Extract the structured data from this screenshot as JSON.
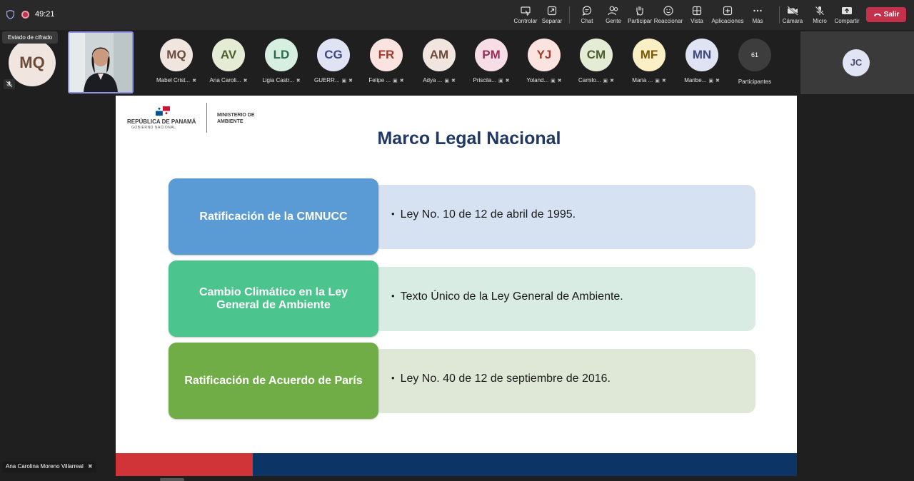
{
  "meeting": {
    "timer": "49:21",
    "tooltip": "Estado de cifrado",
    "self_initials": "MQ",
    "speaker_name": "Ana Carolina Moreno Villarreal"
  },
  "toolbar": {
    "items": [
      {
        "label": "Controlar",
        "icon": "screen-control-icon"
      },
      {
        "label": "Separar",
        "icon": "pop-out-icon"
      },
      {
        "label": "Chat",
        "icon": "chat-icon"
      },
      {
        "label": "Gente",
        "icon": "people-icon"
      },
      {
        "label": "Participar",
        "icon": "raise-hand-icon"
      },
      {
        "label": "Reaccionar",
        "icon": "smiley-icon"
      },
      {
        "label": "Vista",
        "icon": "grid-view-icon"
      },
      {
        "label": "Aplicaciones",
        "icon": "add-apps-icon"
      },
      {
        "label": "Más",
        "icon": "more-icon"
      },
      {
        "label": "Cámara",
        "icon": "camera-off-icon"
      },
      {
        "label": "Micro",
        "icon": "mic-off-icon"
      },
      {
        "label": "Compartir",
        "icon": "share-icon"
      }
    ],
    "leave_label": "Salir",
    "leave_color": "#c4314b"
  },
  "participants": [
    {
      "initials": "MQ",
      "name": "Mabel Crist...",
      "bg": "#f1e6df",
      "fg": "#6b4a3a"
    },
    {
      "initials": "AV",
      "name": "Ana Caroli...",
      "bg": "#e4ecd6",
      "fg": "#4d5e2e"
    },
    {
      "initials": "LD",
      "name": "Ligia Castr...",
      "bg": "#d6efe0",
      "fg": "#2c6a45"
    },
    {
      "initials": "CG",
      "name": "GUERR...",
      "bg": "#dfe3f3",
      "fg": "#3f4a80"
    },
    {
      "initials": "FR",
      "name": "Felipe ...",
      "bg": "#fbe3df",
      "fg": "#a33a2b"
    },
    {
      "initials": "AM",
      "name": "Adya ...",
      "bg": "#f1e6df",
      "fg": "#6b4a3a"
    },
    {
      "initials": "PM",
      "name": "Priscila...",
      "bg": "#f7dde6",
      "fg": "#9a2e5a"
    },
    {
      "initials": "YJ",
      "name": "Yoland...",
      "bg": "#fbe3df",
      "fg": "#a33a2b"
    },
    {
      "initials": "CM",
      "name": "Camilo...",
      "bg": "#e4ecd6",
      "fg": "#4d5e2e"
    },
    {
      "initials": "MF",
      "name": "Maria ...",
      "bg": "#fbefc6",
      "fg": "#7a5a08"
    },
    {
      "initials": "MN",
      "name": "Maribe...",
      "bg": "#dfe3f3",
      "fg": "#3f4a80"
    }
  ],
  "participant_count": "61",
  "participant_count_label": "Participantes",
  "spotlight_initials": "JC",
  "slide": {
    "logo_republic": "REPÚBLICA DE PANAMÁ",
    "logo_gov": "GOBIERNO NACIONAL",
    "logo_ministry": "MINISTERIO DE AMBIENTE",
    "title": "Marco Legal Nacional",
    "rows": [
      {
        "heading": "Ratificación de la CMNUCC",
        "text": "Ley No. 10 de 12 de abril de 1995.",
        "head_color": "#5b9bd5",
        "bg_color": "#d6e2f2"
      },
      {
        "heading": "Cambio Climático en la Ley General de Ambiente",
        "text": "Texto Único de la Ley General de Ambiente.",
        "head_color": "#4cc48e",
        "bg_color": "#d8ece3"
      },
      {
        "heading": "Ratificación de Acuerdo de París",
        "text": "Ley No. 40 de 12 de septiembre de 2016.",
        "head_color": "#70ad47",
        "bg_color": "#dfe8d7"
      }
    ]
  }
}
